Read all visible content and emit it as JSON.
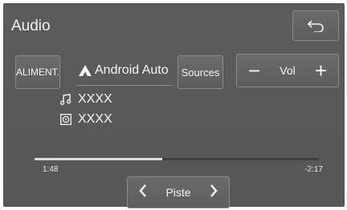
{
  "header": {
    "title": "Audio",
    "back_icon": "back-arrow-icon"
  },
  "controls": {
    "aliment_label": "ALIMENT.",
    "source_name": "Android Auto",
    "source_icon": "android-auto-icon",
    "sources_label": "Sources",
    "vol_label": "Vol",
    "vol_minus": "−",
    "vol_plus": "+"
  },
  "track": {
    "title": "XXXX",
    "title_icon": "music-note-icon",
    "artist": "XXXX",
    "artist_icon": "album-icon"
  },
  "playback": {
    "elapsed": "1:48",
    "remaining": "-2:17",
    "progress_fraction": 0.45
  },
  "footer": {
    "piste_label": "Piste",
    "prev_icon": "chevron-left-icon",
    "next_icon": "chevron-right-icon"
  },
  "colors": {
    "background": "#595959",
    "button": "#636363",
    "text": "#f4f4f4",
    "progress_fill": "#dcdcdc"
  }
}
